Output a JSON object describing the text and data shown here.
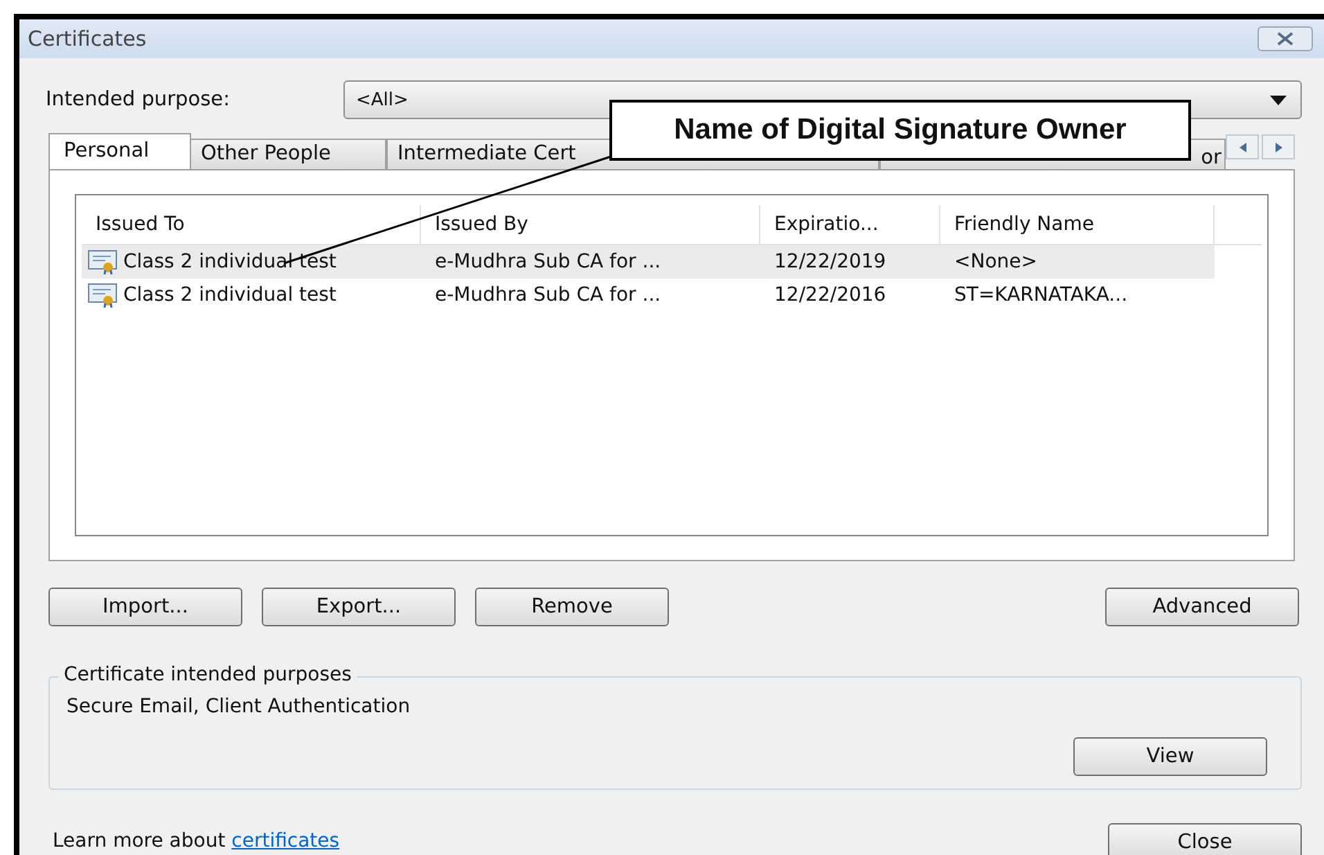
{
  "window": {
    "title": "Certificates"
  },
  "intended_purpose": {
    "label": "Intended purpose:",
    "value": "<All>"
  },
  "tabs": [
    {
      "label": "Personal",
      "selected": true
    },
    {
      "label": "Other People",
      "selected": false
    },
    {
      "label": "Intermediate Cert",
      "selected": false
    },
    {
      "label": "or",
      "selected": false
    }
  ],
  "table": {
    "columns": [
      "Issued To",
      "Issued By",
      "Expiratio...",
      "Friendly Name"
    ],
    "rows": [
      {
        "cells": [
          "Class 2 individual test",
          "e-Mudhra Sub CA for ...",
          "12/22/2019",
          "<None>"
        ],
        "selected": true
      },
      {
        "cells": [
          "Class 2 individual test",
          "e-Mudhra Sub CA for ...",
          "12/22/2016",
          "ST=KARNATAKA..."
        ],
        "selected": false
      }
    ]
  },
  "actions": [
    "Import...",
    "Export...",
    "Remove"
  ],
  "advanced_button": "Advanced",
  "purposes_group": {
    "title": "Certificate intended purposes",
    "text": "Secure Email, Client Authentication",
    "button": "View"
  },
  "footer": {
    "text": "Learn more about",
    "link": "certificates",
    "button": "Close"
  },
  "callout": {
    "text": "Name of Digital Signature Owner"
  }
}
